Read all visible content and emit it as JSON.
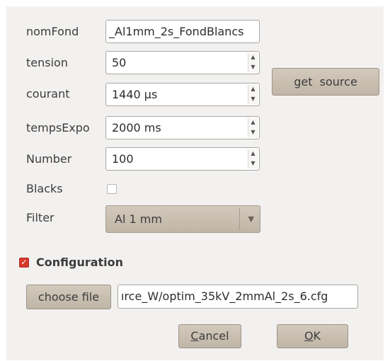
{
  "form": {
    "nomFond": {
      "label": "nomFond",
      "value": "_Al1mm_2s_FondBlancs"
    },
    "tension": {
      "label": "tension",
      "value": "50"
    },
    "courant": {
      "label": "courant",
      "value": "1440 µs"
    },
    "tempsExpo": {
      "label": "tempsExpo",
      "value": "2000 ms"
    },
    "number": {
      "label": "Number",
      "value": "100"
    },
    "blacks": {
      "label": "Blacks",
      "checked": false
    },
    "filter": {
      "label": "Filter",
      "selected": "Al 1 mm"
    }
  },
  "get_source_label": "get  source",
  "configuration": {
    "label": "Configuration",
    "checked": true,
    "choose_file_label": "choose file",
    "file_path": "ırce_W/optim_35kV_2mmAl_2s_6.cfg"
  },
  "buttons": {
    "cancel_mnemonic": "C",
    "cancel_rest": "ancel",
    "ok_mnemonic": "O",
    "ok_rest": "K"
  },
  "icons": {
    "spin_up": "▲",
    "spin_down": "▼",
    "dropdown": "▼",
    "check": "✓"
  },
  "colors": {
    "accent_check": "#d7392d",
    "button_bg": "#c8bfb2"
  }
}
